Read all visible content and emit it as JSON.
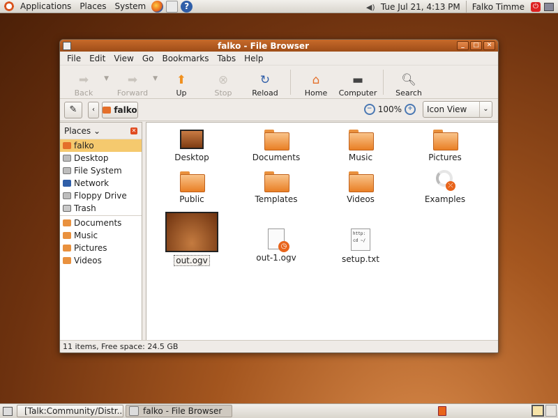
{
  "top_panel": {
    "menus": [
      "Applications",
      "Places",
      "System"
    ],
    "launchers": [
      "firefox-icon",
      "mail-icon",
      "help-icon"
    ],
    "help_glyph": "?",
    "clock": "Tue Jul 21,  4:13 PM",
    "user": "Falko Timme"
  },
  "window": {
    "title": "falko - File Browser",
    "menus": [
      "File",
      "Edit",
      "View",
      "Go",
      "Bookmarks",
      "Tabs",
      "Help"
    ],
    "toolbar": {
      "back": "Back",
      "forward": "Forward",
      "up": "Up",
      "stop": "Stop",
      "reload": "Reload",
      "home": "Home",
      "computer": "Computer",
      "search": "Search"
    },
    "location": {
      "current": "falko",
      "zoom": "100%",
      "view_mode": "Icon View"
    },
    "sidebar": {
      "header": "Places",
      "places": [
        {
          "label": "falko",
          "icon": "home-folder-icon",
          "selected": true
        },
        {
          "label": "Desktop",
          "icon": "desktop-icon"
        },
        {
          "label": "File System",
          "icon": "drive-icon"
        },
        {
          "label": "Network",
          "icon": "network-icon"
        },
        {
          "label": "Floppy Drive",
          "icon": "floppy-icon"
        },
        {
          "label": "Trash",
          "icon": "trash-icon"
        }
      ],
      "bookmarks": [
        {
          "label": "Documents",
          "icon": "folder-icon"
        },
        {
          "label": "Music",
          "icon": "folder-icon"
        },
        {
          "label": "Pictures",
          "icon": "folder-icon"
        },
        {
          "label": "Videos",
          "icon": "folder-icon"
        }
      ]
    },
    "files": [
      {
        "name": "Desktop",
        "type": "desktop"
      },
      {
        "name": "Documents",
        "type": "folder"
      },
      {
        "name": "Music",
        "type": "folder"
      },
      {
        "name": "Pictures",
        "type": "folder"
      },
      {
        "name": "Public",
        "type": "folder"
      },
      {
        "name": "Templates",
        "type": "folder"
      },
      {
        "name": "Videos",
        "type": "folder"
      },
      {
        "name": "Examples",
        "type": "link"
      },
      {
        "name": "out.ogv",
        "type": "video-thumb",
        "selected": true
      },
      {
        "name": "out-1.ogv",
        "type": "video"
      },
      {
        "name": "setup.txt",
        "type": "text",
        "preview": "http:\ncd ~/"
      }
    ],
    "status": "11 items, Free space: 24.5 GB"
  },
  "bottom_panel": {
    "tasks": [
      {
        "label": "[Talk:Community/Distr...",
        "icon": "firefox-icon"
      },
      {
        "label": "falko - File Browser",
        "icon": "file-browser-icon",
        "active": true
      }
    ]
  },
  "colors": {
    "accent": "#e9913e",
    "titlebar": "#b85f22",
    "selection": "#f5c96e"
  }
}
